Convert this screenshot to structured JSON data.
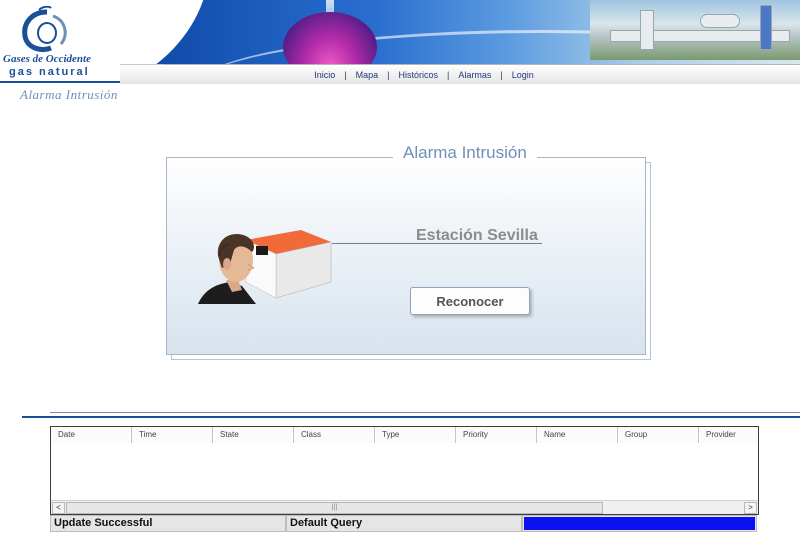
{
  "header": {
    "brand_line1": "Gases de Occidente",
    "brand_line2": "gas natural",
    "page_subtitle": "Alarma Intrusión"
  },
  "nav": {
    "items": [
      {
        "label": "Inicio"
      },
      {
        "label": "Mapa"
      },
      {
        "label": "Históricos"
      },
      {
        "label": "Alarmas"
      },
      {
        "label": "Login"
      }
    ],
    "separator": "|"
  },
  "alarm_panel": {
    "title": "Alarma Intrusión",
    "station": "Estación Sevilla",
    "acknowledge_label": "Reconocer"
  },
  "grid": {
    "columns": [
      "Date",
      "Time",
      "State",
      "Class",
      "Type",
      "Priority",
      "Name",
      "Group",
      "Provider"
    ],
    "scroll_left": "<",
    "scroll_right": ">",
    "scroll_thumb_grip": "|||"
  },
  "status_bar": {
    "message": "Update Successful",
    "query": "Default Query",
    "progress": 1.0
  },
  "colors": {
    "brand_blue": "#1b4f9a",
    "title_blue": "#6f8fb8",
    "progress_blue": "#0a12f0"
  }
}
